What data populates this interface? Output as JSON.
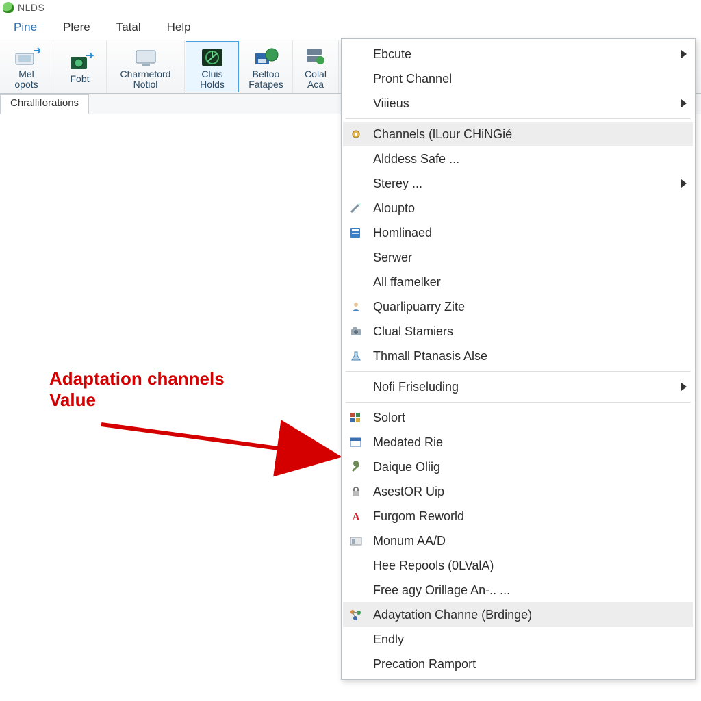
{
  "app": {
    "name": "NLDS"
  },
  "menubar": [
    "Pine",
    "Plere",
    "Tatal",
    "Help"
  ],
  "toolbar": [
    {
      "l1": "Mel",
      "l2": "opots",
      "name": "tool-mel-opots"
    },
    {
      "l1": "Fobt",
      "l2": "",
      "name": "tool-fobt"
    },
    {
      "l1": "Charmetord",
      "l2": "Notiol",
      "name": "tool-charmetord"
    },
    {
      "l1": "Cluis",
      "l2": "Holds",
      "name": "tool-cluis-holds",
      "active": true
    },
    {
      "l1": "Beltoo",
      "l2": "Fatapes",
      "name": "tool-beltoo"
    },
    {
      "l1": "Colal",
      "l2": "Aca",
      "name": "tool-colal"
    }
  ],
  "tabs": [
    {
      "label": "Chralliforations"
    }
  ],
  "context_menu": [
    {
      "label": "Ebcute",
      "icon": "",
      "submenu": true
    },
    {
      "label": "Pront Channel",
      "icon": "",
      "submenu": false
    },
    {
      "label": "Viiieus",
      "icon": "",
      "submenu": true
    },
    {
      "sep": true
    },
    {
      "label": "Channels (lLour CHiNGié",
      "icon": "gear",
      "submenu": false,
      "hover": true
    },
    {
      "label": "Alddess Safe ...",
      "icon": "",
      "submenu": false
    },
    {
      "label": "Sterey ...",
      "icon": "",
      "submenu": true
    },
    {
      "label": "Aloupto",
      "icon": "wand",
      "submenu": false
    },
    {
      "label": "Homlinaed",
      "icon": "form",
      "submenu": false
    },
    {
      "label": "Serwer",
      "icon": "",
      "submenu": false
    },
    {
      "label": "All ffamelker",
      "icon": "",
      "submenu": false
    },
    {
      "label": "Quarlipuarry Zite",
      "icon": "user",
      "submenu": false
    },
    {
      "label": "Clual Stamiers",
      "icon": "camera",
      "submenu": false
    },
    {
      "label": "Thmall Ptanasis Alse",
      "icon": "flask",
      "submenu": false
    },
    {
      "sep": true
    },
    {
      "label": "Nofi Friseluding",
      "icon": "",
      "submenu": true
    },
    {
      "sep": true
    },
    {
      "label": "Solort",
      "icon": "blocks",
      "submenu": false
    },
    {
      "label": "Medated Rie",
      "icon": "window",
      "submenu": false
    },
    {
      "label": "Daique Oliig",
      "icon": "wrench",
      "submenu": false
    },
    {
      "label": "AsestOR Uip",
      "icon": "lock",
      "submenu": false
    },
    {
      "label": "Furgom Reworld",
      "icon": "letter-a",
      "submenu": false
    },
    {
      "label": "Monum AA/D",
      "icon": "panel",
      "submenu": false
    },
    {
      "label": "Hee Repools (0LValA)",
      "icon": "",
      "submenu": false
    },
    {
      "label": "Free agy Orillage An-.. ...",
      "icon": "",
      "submenu": false
    },
    {
      "label": "Adaytation Channe (Brdinge)",
      "icon": "nodes",
      "submenu": false,
      "hover": true
    },
    {
      "label": "Endly",
      "icon": "",
      "submenu": false
    },
    {
      "label": "Precation Ramport",
      "icon": "",
      "submenu": false
    }
  ],
  "annotation": {
    "line1": "Adaptation channels",
    "line2": "Value"
  },
  "colors": {
    "accent": "#4aa3e0",
    "annotation": "#d40000"
  }
}
